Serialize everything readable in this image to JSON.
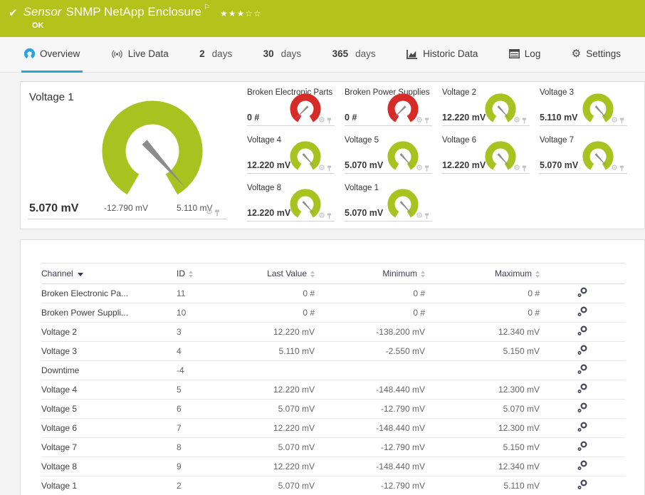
{
  "colors": {
    "green": "#b3c31b",
    "gauge_ok": "#a8c31f",
    "gauge_error": "#d62b26",
    "accent_blue": "#2ca3dc",
    "needle_gray": "#8c8c8c"
  },
  "header": {
    "check_icon": "✔",
    "kind": "Sensor",
    "title": "SNMP NetApp Enclosure",
    "flag_icon": "⚐",
    "stars_filled": "★★★",
    "stars_empty": "☆☆",
    "status": "OK"
  },
  "tabs": [
    {
      "label": "Overview",
      "icon": "gauge-icon",
      "active": true
    },
    {
      "label": "Live Data",
      "icon": "broadcast-icon",
      "active": false
    },
    {
      "num": "2",
      "unit": "days",
      "active": false
    },
    {
      "num": "30",
      "unit": "days",
      "active": false
    },
    {
      "num": "365",
      "unit": "days",
      "active": false
    },
    {
      "label": "Historic Data",
      "icon": "chart-icon",
      "active": false
    },
    {
      "label": "Log",
      "icon": "log-icon",
      "active": false
    },
    {
      "label": "Settings",
      "icon": "gear-icon",
      "active": false
    }
  ],
  "gauges": {
    "primary": {
      "title": "Voltage 1",
      "value": "5.070 mV",
      "min_label": "-12.790 mV",
      "max_label": "5.110 mV",
      "status": "ok"
    },
    "small": [
      {
        "title": "Broken Electronic Parts",
        "value": "0 #",
        "status": "error"
      },
      {
        "title": "Broken Power Supplies",
        "value": "0 #",
        "status": "error"
      },
      {
        "title": "Voltage 2",
        "value": "12.220 mV",
        "status": "ok"
      },
      {
        "title": "Voltage 3",
        "value": "5.110 mV",
        "status": "ok"
      },
      {
        "title": "Voltage 4",
        "value": "12.220 mV",
        "status": "ok"
      },
      {
        "title": "Voltage 5",
        "value": "5.070 mV",
        "status": "ok"
      },
      {
        "title": "Voltage 6",
        "value": "12.220 mV",
        "status": "ok"
      },
      {
        "title": "Voltage 7",
        "value": "5.070 mV",
        "status": "ok"
      },
      {
        "title": "Voltage 8",
        "value": "12.220 mV",
        "status": "ok"
      },
      {
        "title": "Voltage 1",
        "value": "5.070 mV",
        "status": "ok"
      }
    ]
  },
  "table": {
    "headers": {
      "channel": "Channel",
      "id": "ID",
      "last": "Last Value",
      "min": "Minimum",
      "max": "Maximum"
    },
    "sorted_by": "Channel",
    "rows": [
      {
        "channel": "Broken Electronic Pa...",
        "id": "11",
        "last": "0 #",
        "min": "0 #",
        "max": "0 #"
      },
      {
        "channel": "Broken Power Suppli...",
        "id": "10",
        "last": "0 #",
        "min": "0 #",
        "max": "0 #"
      },
      {
        "channel": "Voltage 2",
        "id": "3",
        "last": "12.220 mV",
        "min": "-138.200 mV",
        "max": "12.340 mV"
      },
      {
        "channel": "Voltage 3",
        "id": "4",
        "last": "5.110 mV",
        "min": "-2.550 mV",
        "max": "5.150 mV"
      },
      {
        "channel": "Downtime",
        "id": "-4",
        "last": "",
        "min": "",
        "max": ""
      },
      {
        "channel": "Voltage 4",
        "id": "5",
        "last": "12.220 mV",
        "min": "-148.440 mV",
        "max": "12.300 mV"
      },
      {
        "channel": "Voltage 5",
        "id": "6",
        "last": "5.070 mV",
        "min": "-12.790 mV",
        "max": "5.070 mV"
      },
      {
        "channel": "Voltage 6",
        "id": "7",
        "last": "12.220 mV",
        "min": "-148.440 mV",
        "max": "12.300 mV"
      },
      {
        "channel": "Voltage 7",
        "id": "8",
        "last": "5.070 mV",
        "min": "-12.790 mV",
        "max": "5.150 mV"
      },
      {
        "channel": "Voltage 8",
        "id": "9",
        "last": "12.220 mV",
        "min": "-148.440 mV",
        "max": "12.340 mV"
      },
      {
        "channel": "Voltage 1",
        "id": "2",
        "last": "5.070 mV",
        "min": "-12.790 mV",
        "max": "5.110 mV"
      }
    ]
  }
}
